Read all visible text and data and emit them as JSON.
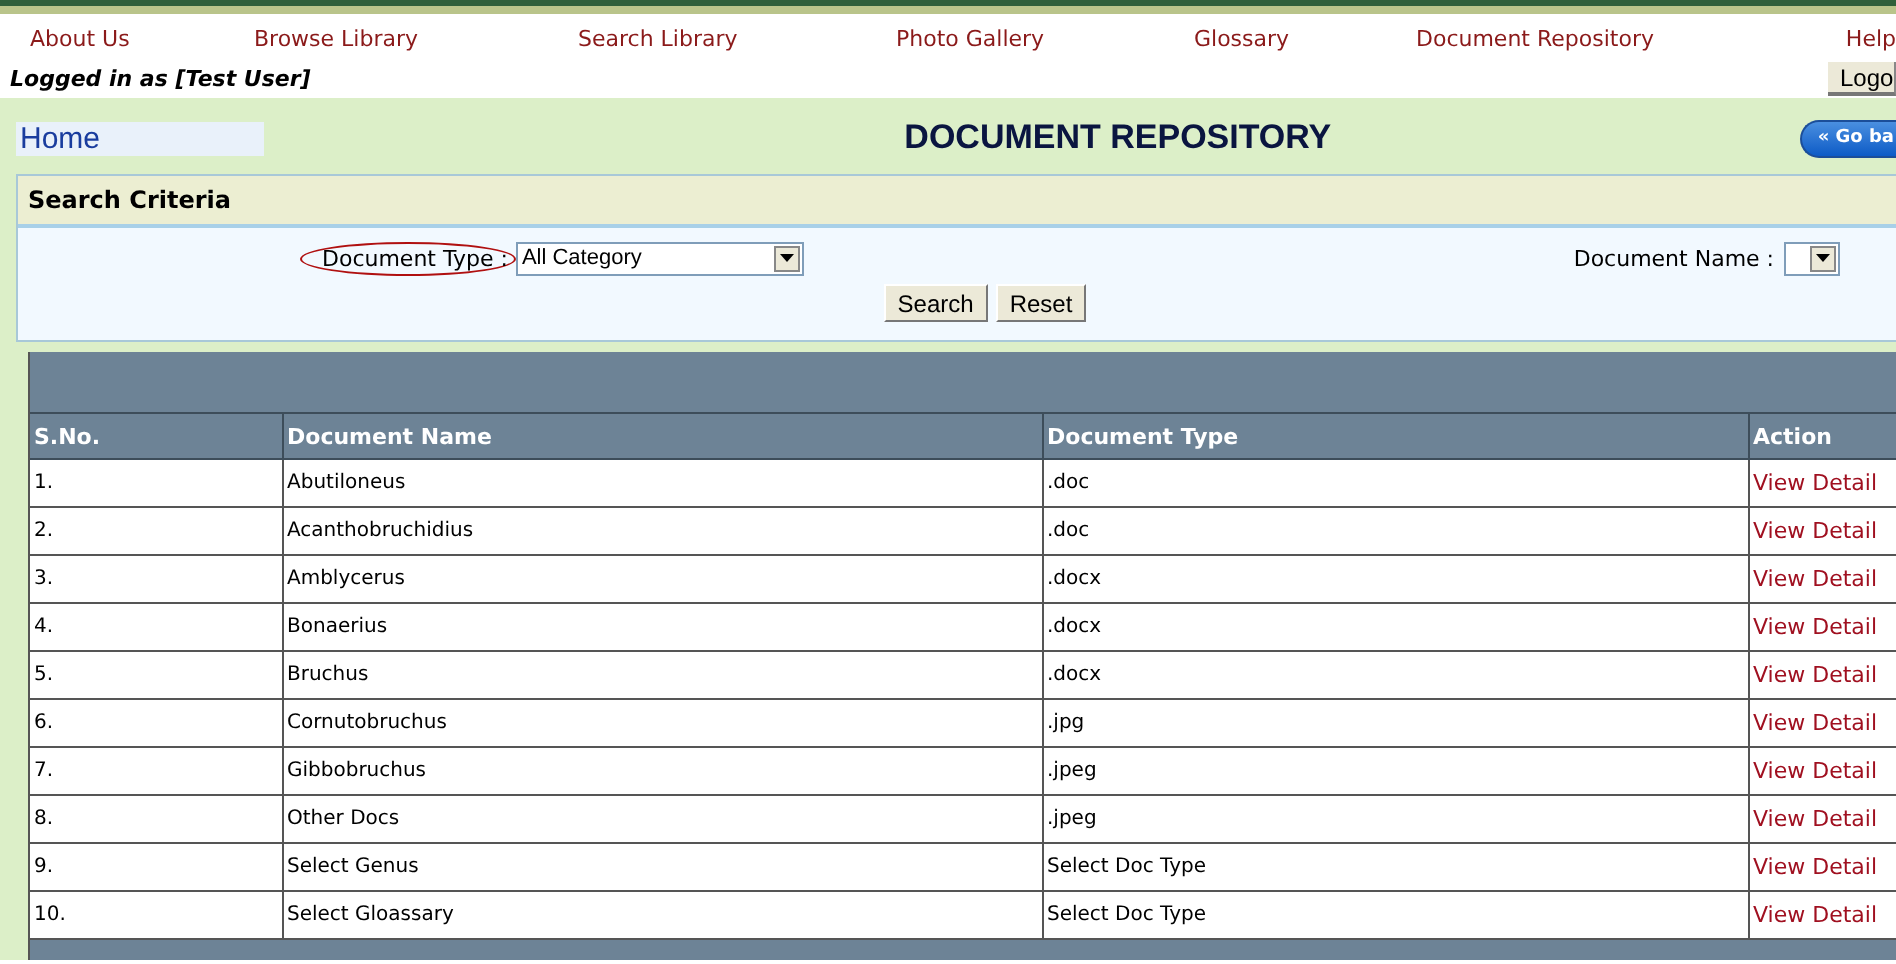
{
  "nav": [
    "About Us",
    "Browse Library",
    "Search Library",
    "Photo Gallery",
    "Glossary",
    "Document Repository",
    "Help"
  ],
  "user_line": "Logged in as [Test User]",
  "logout_button": "Logo",
  "home_link": "Home",
  "page_title": "DOCUMENT REPOSITORY",
  "go_back_button": "« Go ba",
  "search_panel": {
    "title": "Search Criteria",
    "document_type": {
      "label": "Document Type :",
      "value": "All Category"
    },
    "document_name": {
      "label": "Document Name :"
    },
    "buttons": [
      "Search",
      "Reset"
    ]
  },
  "table": {
    "columns": [
      "S.No.",
      "Document Name",
      "Document Type",
      "Action"
    ],
    "rows": [
      {
        "sno": "1.",
        "name": "Abutiloneus",
        "type": ".doc",
        "action": "View Detail"
      },
      {
        "sno": "2.",
        "name": "Acanthobruchidius",
        "type": ".doc",
        "action": "View Detail"
      },
      {
        "sno": "3.",
        "name": "Amblycerus",
        "type": ".docx",
        "action": "View Detail"
      },
      {
        "sno": "4.",
        "name": "Bonaerius",
        "type": ".docx",
        "action": "View Detail"
      },
      {
        "sno": "5.",
        "name": "Bruchus",
        "type": ".docx",
        "action": "View Detail"
      },
      {
        "sno": "6.",
        "name": "Cornutobruchus",
        "type": ".jpg",
        "action": "View Detail"
      },
      {
        "sno": "7.",
        "name": "Gibbobruchus",
        "type": ".jpeg",
        "action": "View Detail"
      },
      {
        "sno": "8.",
        "name": "Other Docs",
        "type": ".jpeg",
        "action": "View Detail"
      },
      {
        "sno": "9.",
        "name": "Select Genus",
        "type": "Select Doc Type",
        "action": "View Detail"
      },
      {
        "sno": "10.",
        "name": "Select Gloassary",
        "type": "Select Doc Type",
        "action": "View Detail"
      }
    ]
  }
}
